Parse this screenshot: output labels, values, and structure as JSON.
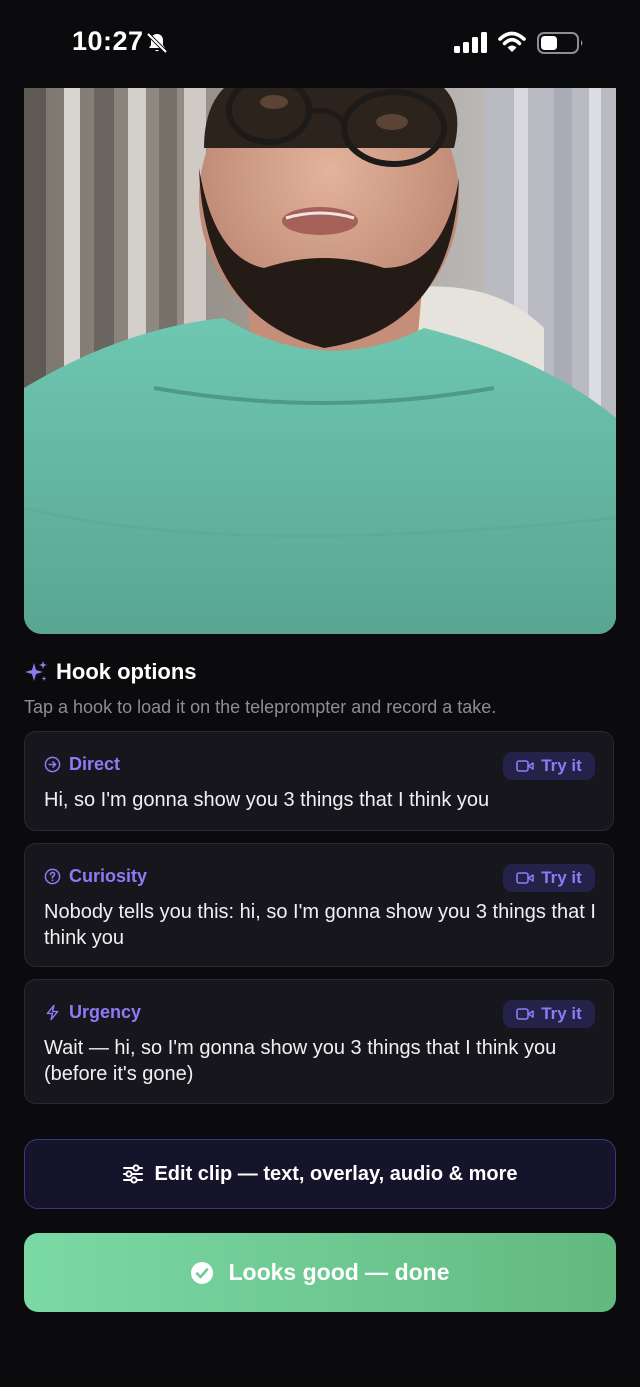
{
  "status_bar": {
    "time": "10:27",
    "icons": [
      "bell-slash-icon",
      "cellular-signal-icon",
      "wifi-icon",
      "battery-icon"
    ]
  },
  "video_preview": {
    "icon": "video-frame"
  },
  "hooks": {
    "title": "Hook options",
    "title_icon": "sparkle-icon",
    "subtitle": "Tap a hook to load it on the teleprompter and record a take.",
    "accent_color": "#8b7cf6",
    "items": [
      {
        "label": "Direct",
        "icon": "arrow-circle-icon",
        "text": "Hi, so I'm gonna show you 3 things that I think you",
        "action": "Try it"
      },
      {
        "label": "Curiosity",
        "icon": "question-circle-icon",
        "text": "Nobody tells you this: hi, so I'm gonna show you 3 things that I think you",
        "action": "Try it"
      },
      {
        "label": "Urgency",
        "icon": "lightning-icon",
        "text": "Wait — hi, so I'm gonna show you 3 things that I think you (before it's gone)",
        "action": "Try it"
      }
    ]
  },
  "actions": {
    "edit_label": "Edit clip — text, overlay, audio & more",
    "edit_icon": "sliders-icon",
    "done_label": "Looks good — done",
    "done_icon": "check-circle-icon",
    "done_color": "#6fc994"
  }
}
